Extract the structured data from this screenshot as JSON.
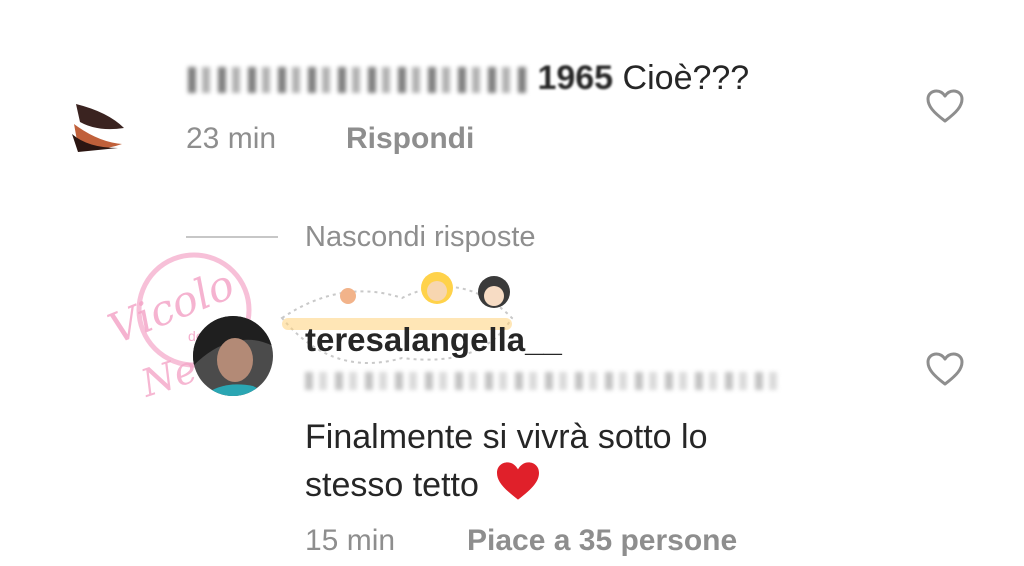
{
  "comment1": {
    "handle_suffix": "1965",
    "text": "Cioè???",
    "time": "23 min",
    "reply_label": "Rispondi"
  },
  "thread": {
    "toggle_label": "Nascondi risposte"
  },
  "comment2": {
    "username": "teresalangella__",
    "text_line1": "Finalmente si vivrà sotto lo",
    "text_line2": "stesso tetto",
    "emoji": "❤️",
    "time": "15 min",
    "likes_label": "Piace a 35 persone"
  },
  "watermark": {
    "logo_text_main": "Vicolo",
    "logo_text_small": "della",
    "logo_text_tail": "News"
  },
  "colors": {
    "text": "#262626",
    "meta": "#8e8e8e",
    "heart_emoji": "#e0202a",
    "like_icon": "#8e8e8e",
    "watermark_pink": "#f4a6c8"
  },
  "icons": {
    "like": "heart-outline-icon"
  }
}
